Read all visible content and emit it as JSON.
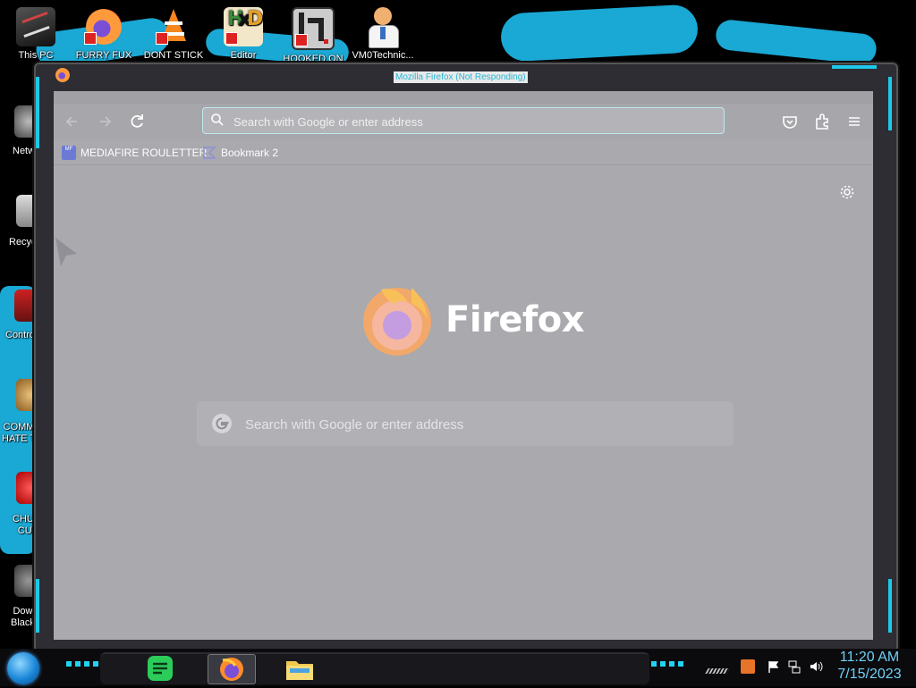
{
  "colors": {
    "accent_cyan": "#1ec8e8",
    "firefox_bg": "#a9a9ae",
    "clock_text": "#6fd0f5",
    "title_text": "#27b7d6"
  },
  "desktop": {
    "top_icons": [
      {
        "label": "This PC",
        "icon": "computer-icon"
      },
      {
        "label": "FURRY FUX",
        "icon": "firefox-icon"
      },
      {
        "label": "DONT STICK",
        "icon": "vlc-icon"
      },
      {
        "label": "Editor",
        "icon": "hex-editor-icon"
      },
      {
        "label": "HOOKED ON",
        "icon": "game-icon"
      },
      {
        "label": "VM0Technic...",
        "icon": "doctor-icon"
      }
    ],
    "side_icons": [
      {
        "label": "Netw",
        "icon": "network-icon"
      },
      {
        "label": "Recycl",
        "icon": "recycle-bin-icon"
      },
      {
        "label": "Control",
        "icon": "control-panel-icon"
      },
      {
        "label_line1": "COMMU",
        "label_line2": "HATE TH",
        "icon": "money-bag-icon"
      },
      {
        "label_line1": "CHUZ",
        "label_line2": "CUI",
        "icon": "clown-icon"
      },
      {
        "label_line1": "Dow",
        "label_line2": "Black",
        "icon": "download-icon"
      }
    ]
  },
  "window": {
    "title": "Mozilla Firefox (Not Responding)"
  },
  "browser": {
    "url_placeholder": "Search with Google or enter address",
    "bookmarks": [
      {
        "label": "MEDIAFIRE ROULETTER",
        "icon": "mediafire-icon"
      },
      {
        "label": "Bookmark 2",
        "icon": "bookmark-folder-icon"
      }
    ],
    "brand_name": "Firefox",
    "search_placeholder": "Search with Google or enter address"
  },
  "taskbar": {
    "time": "11:20 AM",
    "date": "7/15/2023"
  }
}
